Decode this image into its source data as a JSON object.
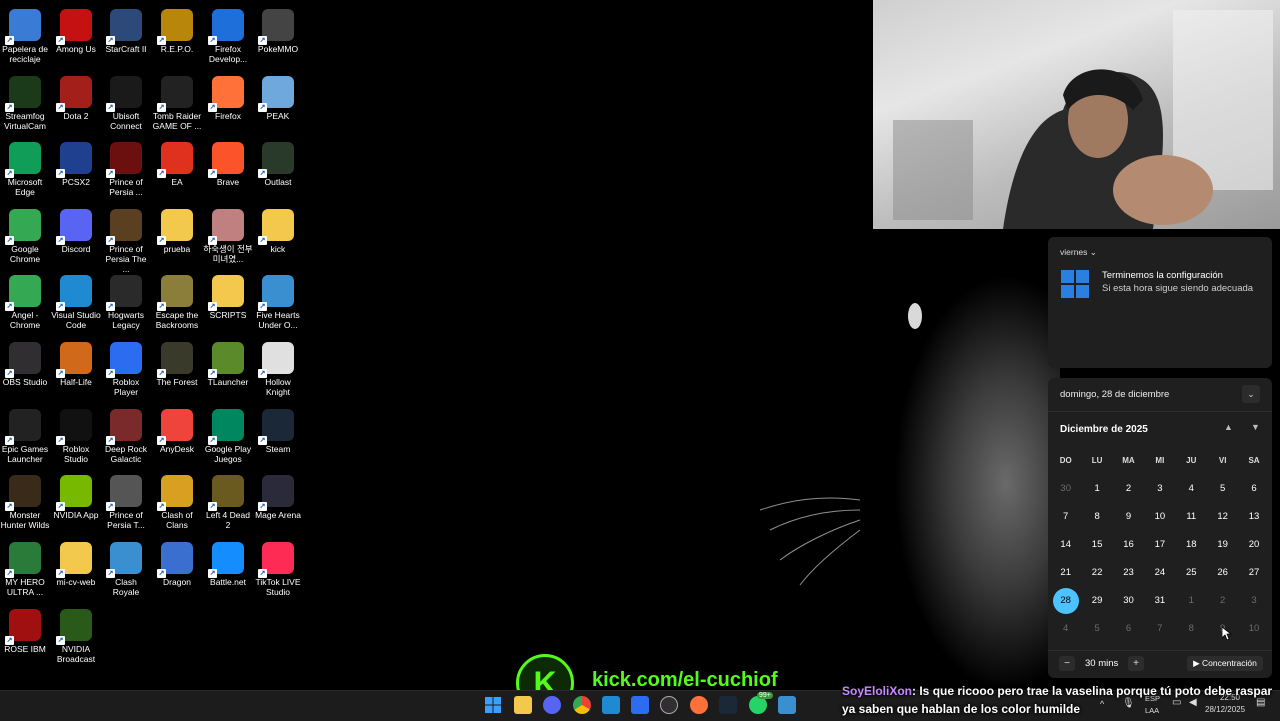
{
  "desktop": {
    "icons": [
      {
        "label": "Papelera de reciclaje",
        "icon": "recycle-bin-icon",
        "color": "#3a7bd5"
      },
      {
        "label": "Among Us",
        "icon": "among-us-icon",
        "color": "#c51111"
      },
      {
        "label": "StarCraft II",
        "icon": "starcraft-icon",
        "color": "#2b4a7a"
      },
      {
        "label": "R.E.P.O.",
        "icon": "repo-icon",
        "color": "#b8860b"
      },
      {
        "label": "Firefox Develop...",
        "icon": "firefox-dev-icon",
        "color": "#1e6fd9"
      },
      {
        "label": "PokeMMO",
        "icon": "pokemmo-icon",
        "color": "#444444"
      },
      {
        "label": "Streamfog VirtualCam",
        "icon": "streamfog-icon",
        "color": "#1a3a1a"
      },
      {
        "label": "Dota 2",
        "icon": "dota2-icon",
        "color": "#a3201a"
      },
      {
        "label": "Ubisoft Connect",
        "icon": "ubisoft-icon",
        "color": "#1a1a1a"
      },
      {
        "label": "Tomb Raider GAME OF ...",
        "icon": "tomb-raider-icon",
        "color": "#222222"
      },
      {
        "label": "Firefox",
        "icon": "firefox-icon",
        "color": "#ff7139"
      },
      {
        "label": "PEAK",
        "icon": "peak-icon",
        "color": "#6fa8dc"
      },
      {
        "label": "Microsoft Edge",
        "icon": "edge-icon",
        "color": "#0f9d58"
      },
      {
        "label": "PCSX2",
        "icon": "pcsx2-icon",
        "color": "#1f3f8f"
      },
      {
        "label": "Prince of Persia ...",
        "icon": "prince-persia-icon",
        "color": "#6b0f0f"
      },
      {
        "label": "EA",
        "icon": "ea-icon",
        "color": "#e0301e"
      },
      {
        "label": "Brave",
        "icon": "brave-icon",
        "color": "#fb542b"
      },
      {
        "label": "Outlast",
        "icon": "outlast-icon",
        "color": "#2a3a2a"
      },
      {
        "label": "Google Chrome",
        "icon": "chrome-icon",
        "color": "#34a853"
      },
      {
        "label": "Discord",
        "icon": "discord-icon",
        "color": "#5865f2"
      },
      {
        "label": "Prince of Persia The ...",
        "icon": "prince-persia-2-icon",
        "color": "#5a4020"
      },
      {
        "label": "prueba",
        "icon": "folder-icon",
        "color": "#f2c94c"
      },
      {
        "label": "하숙생이 전부 미녀였...",
        "icon": "game-icon",
        "color": "#c08080"
      },
      {
        "label": "kick",
        "icon": "folder-icon",
        "color": "#f2c94c"
      },
      {
        "label": "Angel - Chrome",
        "icon": "chrome-profile-icon",
        "color": "#34a853"
      },
      {
        "label": "Visual Studio Code",
        "icon": "vscode-icon",
        "color": "#1f8ad2"
      },
      {
        "label": "Hogwarts Legacy",
        "icon": "hogwarts-icon",
        "color": "#2a2a2a"
      },
      {
        "label": "Escape the Backrooms",
        "icon": "backrooms-icon",
        "color": "#8b7d3a"
      },
      {
        "label": "SCRIPTS",
        "icon": "folder-icon",
        "color": "#f2c94c"
      },
      {
        "label": "Five Hearts Under O...",
        "icon": "globe-icon",
        "color": "#3a8fd0"
      },
      {
        "label": "OBS Studio",
        "icon": "obs-icon",
        "color": "#302e31"
      },
      {
        "label": "Half-Life",
        "icon": "half-life-icon",
        "color": "#d06a1a"
      },
      {
        "label": "Roblox Player",
        "icon": "roblox-icon",
        "color": "#2b6cf0"
      },
      {
        "label": "The Forest",
        "icon": "the-forest-icon",
        "color": "#3a3a2a"
      },
      {
        "label": "TLauncher",
        "icon": "minecraft-icon",
        "color": "#5a8a2a"
      },
      {
        "label": "Hollow Knight",
        "icon": "hollow-knight-icon",
        "color": "#e0e0e0"
      },
      {
        "label": "Epic Games Launcher",
        "icon": "epic-icon",
        "color": "#222222"
      },
      {
        "label": "Roblox Studio",
        "icon": "roblox-studio-icon",
        "color": "#111111"
      },
      {
        "label": "Deep Rock Galactic",
        "icon": "deep-rock-icon",
        "color": "#7a2a2a"
      },
      {
        "label": "AnyDesk",
        "icon": "anydesk-icon",
        "color": "#ef443b"
      },
      {
        "label": "Google Play Juegos",
        "icon": "google-play-icon",
        "color": "#01875f"
      },
      {
        "label": "Steam",
        "icon": "steam-icon",
        "color": "#1b2838"
      },
      {
        "label": "Monster Hunter Wilds",
        "icon": "monster-hunter-icon",
        "color": "#3a2a1a"
      },
      {
        "label": "NVIDIA App",
        "icon": "nvidia-icon",
        "color": "#76b900"
      },
      {
        "label": "Prince of Persia T...",
        "icon": "prince-persia-3-icon",
        "color": "#555555"
      },
      {
        "label": "Clash of Clans",
        "icon": "clash-of-clans-icon",
        "color": "#d8a020"
      },
      {
        "label": "Left 4 Dead 2",
        "icon": "left4dead-icon",
        "color": "#6a5a20"
      },
      {
        "label": "Mage Arena",
        "icon": "mage-arena-icon",
        "color": "#2a2a3a"
      },
      {
        "label": "MY HERO ULTRA ...",
        "icon": "my-hero-icon",
        "color": "#2a7a3a"
      },
      {
        "label": "mi-cv-web",
        "icon": "folder-icon",
        "color": "#f2c94c"
      },
      {
        "label": "Clash Royale",
        "icon": "clash-royale-icon",
        "color": "#3a8fd0"
      },
      {
        "label": "Dragon",
        "icon": "dragon-icon",
        "color": "#3a6fd0"
      },
      {
        "label": "Battle.net",
        "icon": "battlenet-icon",
        "color": "#148eff"
      },
      {
        "label": "TikTok LIVE Studio",
        "icon": "tiktok-icon",
        "color": "#fe2c55"
      },
      {
        "label": "ROSE IBM",
        "icon": "rose-icon",
        "color": "#a01010"
      },
      {
        "label": "NVIDIA Broadcast",
        "icon": "nvidia-broadcast-icon",
        "color": "#2a5a1a"
      }
    ]
  },
  "notification": {
    "day_header": "viernes",
    "title": "Terminemos la configuración",
    "body": "Si esta hora sigue siendo adecuada"
  },
  "calendar": {
    "full_date": "domingo, 28 de diciembre",
    "month_title": "Diciembre de 2025",
    "weekdays": [
      "DO",
      "LU",
      "MA",
      "MI",
      "JU",
      "VI",
      "SA"
    ],
    "weeks": [
      [
        [
          "30",
          true
        ],
        [
          "1",
          false
        ],
        [
          "2",
          false
        ],
        [
          "3",
          false
        ],
        [
          "4",
          false
        ],
        [
          "5",
          false
        ],
        [
          "6",
          false
        ]
      ],
      [
        [
          "7",
          false
        ],
        [
          "8",
          false
        ],
        [
          "9",
          false
        ],
        [
          "10",
          false
        ],
        [
          "11",
          false
        ],
        [
          "12",
          false
        ],
        [
          "13",
          false
        ]
      ],
      [
        [
          "14",
          false
        ],
        [
          "15",
          false
        ],
        [
          "16",
          false
        ],
        [
          "17",
          false
        ],
        [
          "18",
          false
        ],
        [
          "19",
          false
        ],
        [
          "20",
          false
        ]
      ],
      [
        [
          "21",
          false
        ],
        [
          "22",
          false
        ],
        [
          "23",
          false
        ],
        [
          "24",
          false
        ],
        [
          "25",
          false
        ],
        [
          "26",
          false
        ],
        [
          "27",
          false
        ]
      ],
      [
        [
          "28",
          false
        ],
        [
          "29",
          false
        ],
        [
          "30",
          false
        ],
        [
          "31",
          false
        ],
        [
          "1",
          true
        ],
        [
          "2",
          true
        ],
        [
          "3",
          true
        ]
      ],
      [
        [
          "4",
          true
        ],
        [
          "5",
          true
        ],
        [
          "6",
          true
        ],
        [
          "7",
          true
        ],
        [
          "8",
          true
        ],
        [
          "9",
          true
        ],
        [
          "10",
          true
        ]
      ]
    ],
    "today": "28",
    "focus_minutes": "30 mins",
    "focus_button": "Concentración",
    "minus": "−",
    "plus": "+"
  },
  "overlay": {
    "kick_letter": "K",
    "kick_url": "kick.com/el-cuchiof"
  },
  "chat": {
    "user": "SoyEloliXon",
    "message": ": Is que ricooo pero trae la vaselina porque tú poto debe raspar ya saben que hablan de los color humilde"
  },
  "taskbar": {
    "lang_top": "ESP",
    "lang_bottom": "LAA",
    "time": "22:50",
    "date": "28/12/2025",
    "badge": "99+"
  },
  "colors": {
    "accent": "#4cc2ff",
    "kick_green": "#53fc18",
    "chat_user": "#c58cff"
  }
}
